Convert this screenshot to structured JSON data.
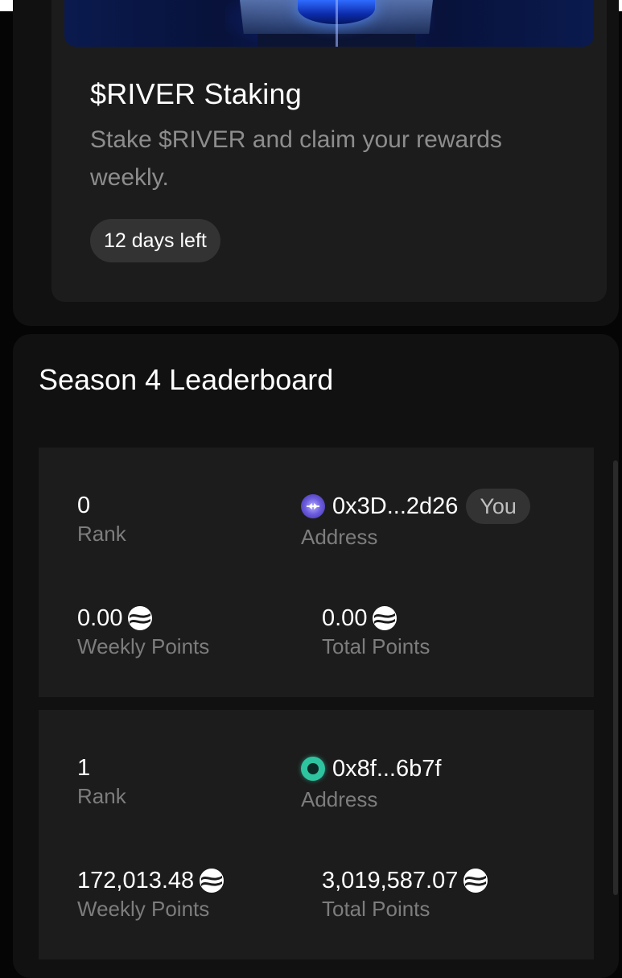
{
  "staking": {
    "title": "$RIVER Staking",
    "description": "Stake $RIVER and claim your rewards weekly.",
    "days_left": "12 days left"
  },
  "leaderboard": {
    "title": "Season 4 Leaderboard",
    "labels": {
      "rank": "Rank",
      "address": "Address",
      "weekly_points": "Weekly Points",
      "total_points": "Total Points"
    },
    "you_badge": "You",
    "entries": [
      {
        "rank": "0",
        "address": "0x3D...2d26",
        "avatar_icon": "purple-diamond-avatar-icon",
        "weekly_points": "0.00",
        "total_points": "0.00",
        "is_you": true
      },
      {
        "rank": "1",
        "address": "0x8f...6b7f",
        "avatar_icon": "teal-ring-avatar-icon",
        "weekly_points": "172,013.48",
        "total_points": "3,019,587.07",
        "is_you": false
      }
    ]
  },
  "colors": {
    "background": "#050505",
    "card": "#111111",
    "inner_card": "#1c1c1c",
    "muted_text": "#7d7d7d",
    "pill": "#333333",
    "avatar_purple": "#6f5fe0",
    "avatar_teal": "#2ec4a0"
  },
  "icons": {
    "points": "river-points-icon"
  }
}
